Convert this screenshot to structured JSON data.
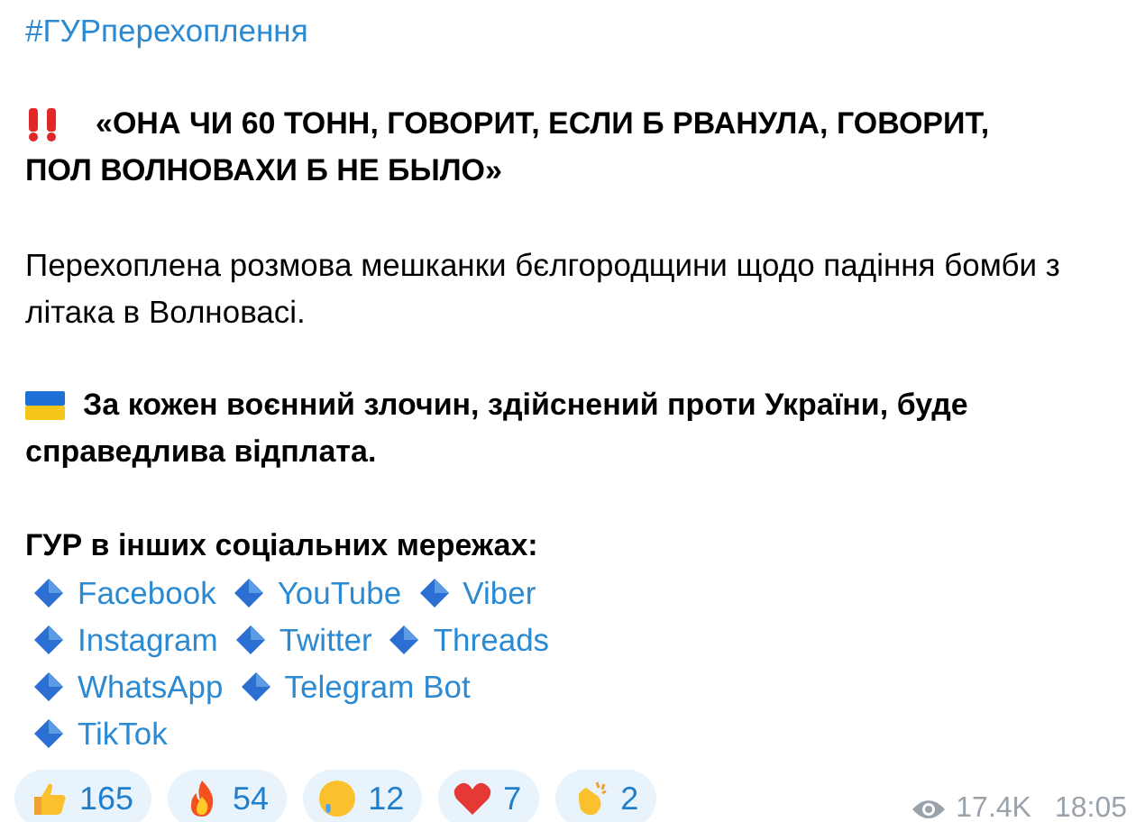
{
  "hashtag": "#ГУРперехоплення",
  "headline_lines": [
    "«ОНА ЧИ 60 ТОНН, ГОВОРИТ, ЕСЛИ Б РВАНУЛА, ГОВОРИТ,",
    "ПОЛ ВОЛНОВАХИ Б НЕ БЫЛО»"
  ],
  "description": "Перехоплена розмова мешканки бєлгородщини щодо падіння бомби з літака в Волновасі.",
  "statement_lines": [
    "За кожен воєнний злочин, здійснений проти України, буде",
    "справедлива відплата."
  ],
  "socials_heading": "ГУР в інших соціальних мережах:",
  "social_links": [
    [
      {
        "label": "Facebook"
      },
      {
        "label": "YouTube"
      },
      {
        "label": "Viber"
      }
    ],
    [
      {
        "label": "Instagram"
      },
      {
        "label": "Twitter"
      },
      {
        "label": "Threads"
      }
    ],
    [
      {
        "label": "WhatsApp"
      },
      {
        "label": "Telegram Bot"
      }
    ],
    [
      {
        "label": "TikTok"
      }
    ]
  ],
  "reactions": [
    {
      "kind": "thumbs",
      "count": "165"
    },
    {
      "kind": "fire",
      "count": "54"
    },
    {
      "kind": "cry",
      "count": "12"
    },
    {
      "kind": "heart",
      "count": "7"
    },
    {
      "kind": "clap",
      "count": "2"
    }
  ],
  "views": "17.4K",
  "time": "18:05"
}
